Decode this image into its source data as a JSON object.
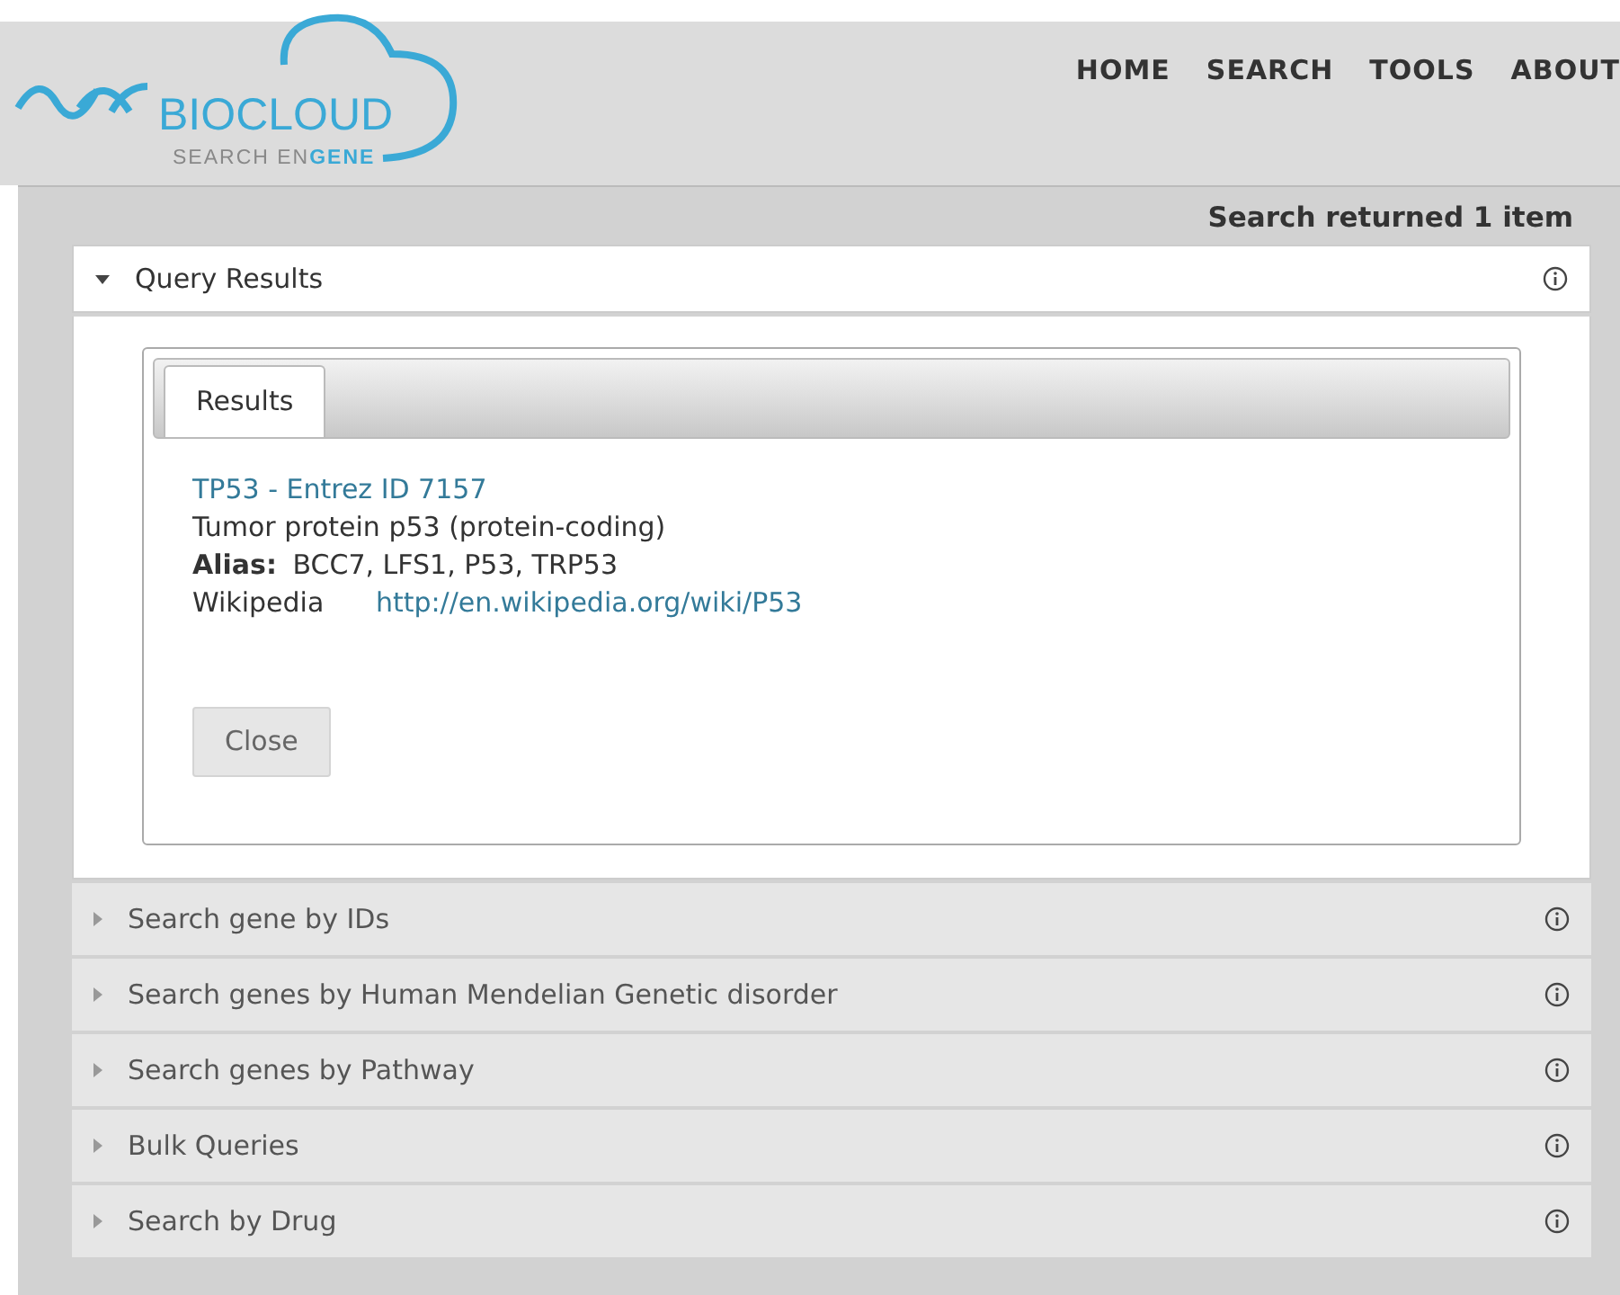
{
  "logo": {
    "name": "BIOCLOUD",
    "tagline": "SEARCH EN**GENE**"
  },
  "nav": [
    "HOME",
    "SEARCH",
    "TOOLS",
    "ABOUT"
  ],
  "status": "Search returned 1 item",
  "sections": [
    {
      "title": "Query Results",
      "expanded": true,
      "tabs": [
        {
          "label": "Results",
          "selected": true
        }
      ],
      "result": {
        "heading": "TP53 - Entrez ID 7157",
        "description": "Tumor protein p53 (protein-coding)",
        "alias_label": "Alias:",
        "alias": "BCC7, LFS1, P53, TRP53",
        "wiki_label": "Wikipedia",
        "wiki_url": "http://en.wikipedia.org/wiki/P53"
      },
      "close": "Close"
    },
    {
      "title": "Search gene by IDs",
      "expanded": false
    },
    {
      "title": "Search genes by Human Mendelian Genetic disorder",
      "expanded": false
    },
    {
      "title": "Search genes by Pathway",
      "expanded": false
    },
    {
      "title": "Bulk Queries",
      "expanded": false
    },
    {
      "title": "Search by Drug",
      "expanded": false
    }
  ]
}
